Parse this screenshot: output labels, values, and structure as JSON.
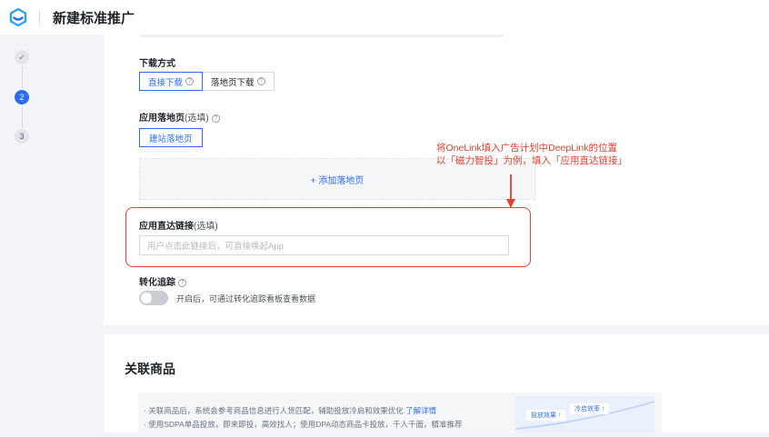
{
  "header": {
    "title": "新建标准推广"
  },
  "stepper": {
    "steps": [
      "",
      "2",
      "3"
    ]
  },
  "download": {
    "label": "下载方式",
    "options": [
      {
        "label": "直接下载",
        "selected": true
      },
      {
        "label": "落地页下载",
        "selected": false
      }
    ]
  },
  "landing": {
    "label": "应用落地页",
    "optional": "(选填)",
    "build_button": "建站落地页",
    "add_label": "+ 添加落地页"
  },
  "annotation": {
    "line1": "将OneLink填入广告计划中DeepLink的位置",
    "line2": "以「磁力智投」为例，填入「应用直达链接」"
  },
  "deeplink": {
    "label": "应用直达链接",
    "optional": "(选填)",
    "placeholder": "用户点击此链接后，可直接唤起App"
  },
  "conversion": {
    "label": "转化追踪",
    "toggle_on": false,
    "hint": "开启后，可通过转化追踪看板查看数据"
  },
  "related": {
    "title": "关联商品",
    "line1": "· 关联商品后，系统会参考商品信息进行人货匹配，辅助投放冷启和效果优化",
    "link": "了解详情",
    "line2": "· 使用SDPA单品投放，即来即投，高效找人；使用DPA动态商品卡投放，千人千面，精准推荐",
    "pill1": "投放效果 ↑",
    "pill2": "冷启效率 ↑"
  },
  "colors": {
    "accent": "#2a6df4",
    "annotation": "#e8402f"
  }
}
